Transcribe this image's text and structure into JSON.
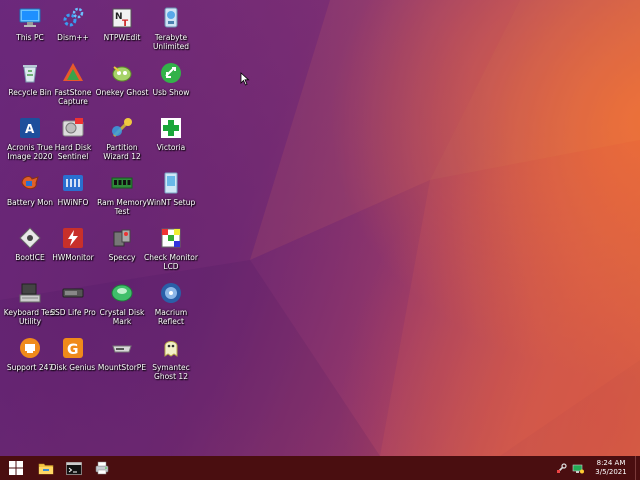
{
  "desktop": {
    "icons": [
      {
        "label": "This PC",
        "icon": "this-pc-icon"
      },
      {
        "label": "Dism++",
        "icon": "dism-gear-icon"
      },
      {
        "label": "NTPWEdit",
        "icon": "ntpwedit-icon"
      },
      {
        "label": "Terabyte Unlimited",
        "icon": "terabyte-icon"
      },
      {
        "label": "Recycle Bin",
        "icon": "recycle-bin-icon"
      },
      {
        "label": "FastStone Capture",
        "icon": "faststone-icon"
      },
      {
        "label": "Onekey Ghost",
        "icon": "onekey-ghost-icon"
      },
      {
        "label": "Usb Show",
        "icon": "usb-show-icon"
      },
      {
        "label": "Acronis True Image 2020",
        "icon": "acronis-icon"
      },
      {
        "label": "Hard Disk Sentinel",
        "icon": "hard-disk-sentinel-icon"
      },
      {
        "label": "Partition Wizard 12",
        "icon": "partition-wizard-icon"
      },
      {
        "label": "Victoria",
        "icon": "victoria-cross-icon"
      },
      {
        "label": "Battery Mon",
        "icon": "battery-mon-icon"
      },
      {
        "label": "HWiNFO",
        "icon": "hwinfo-icon"
      },
      {
        "label": "Ram Memory Test",
        "icon": "ram-icon"
      },
      {
        "label": "WinNT Setup",
        "icon": "winnt-setup-icon"
      },
      {
        "label": "BootICE",
        "icon": "bootice-icon"
      },
      {
        "label": "HWMonitor",
        "icon": "hwmonitor-icon"
      },
      {
        "label": "Speccy",
        "icon": "speccy-icon"
      },
      {
        "label": "Check Monitor LCD",
        "icon": "check-monitor-icon"
      },
      {
        "label": "Keyboard Test Utility",
        "icon": "keyboard-test-icon"
      },
      {
        "label": "SSD Life Pro",
        "icon": "ssd-icon"
      },
      {
        "label": "Crystal Disk Mark",
        "icon": "crystal-disk-icon"
      },
      {
        "label": "Macrium Reflect",
        "icon": "macrium-icon"
      },
      {
        "label": "Support 247",
        "icon": "support-icon"
      },
      {
        "label": "Disk Genius",
        "icon": "disk-genius-icon"
      },
      {
        "label": "MountStorPE",
        "icon": "mountstorpe-icon"
      },
      {
        "label": "Symantec Ghost 12",
        "icon": "symantec-ghost-icon"
      }
    ]
  },
  "taskbar": {
    "start_icon": "windows-logo-icon",
    "pinned": [
      {
        "icon": "file-explorer-icon"
      },
      {
        "icon": "command-prompt-icon"
      },
      {
        "icon": "network-printer-icon"
      }
    ],
    "tray_icons": [
      "tools-tray-icon",
      "network-tray-icon"
    ],
    "clock": {
      "time": "8:24 AM",
      "date": "3/5/2021"
    }
  },
  "colors": {
    "taskbar": "#4a0e10",
    "wallpaper_purple": "#6e2a7e",
    "wallpaper_orange": "#d8673f"
  }
}
